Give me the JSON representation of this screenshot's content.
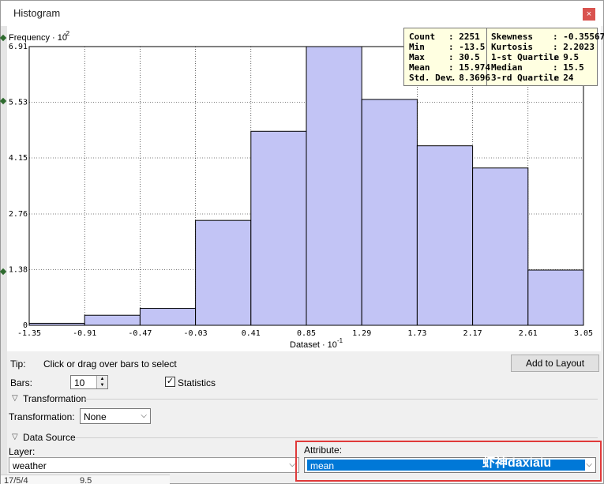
{
  "window": {
    "title": "Histogram",
    "close_glyph": "×"
  },
  "chart_data": {
    "type": "bar",
    "y_axis_title": "Frequency · 10",
    "y_exponent": "-2",
    "x_axis_title": "Dataset · 10",
    "x_exponent": "-1",
    "x_ticks": [
      "-1.35",
      "-0.91",
      "-0.47",
      "-0.03",
      "0.41",
      "0.85",
      "1.29",
      "1.73",
      "2.17",
      "2.61",
      "3.05"
    ],
    "y_ticks": [
      "0",
      "1.38",
      "2.76",
      "4.15",
      "5.53",
      "6.91"
    ],
    "ylim": [
      0,
      6.91
    ],
    "bin_edges": [
      -1.35,
      -0.91,
      -0.47,
      -0.03,
      0.41,
      0.85,
      1.29,
      1.73,
      2.17,
      2.61,
      3.05
    ],
    "values": [
      0.05,
      0.25,
      0.42,
      2.6,
      4.81,
      7.42,
      5.6,
      4.45,
      3.9,
      1.37
    ],
    "grid": true,
    "bar_color": "#c2c4f5",
    "edge_color": "#000000",
    "clipped_bar_index": 8
  },
  "statistics": {
    "rows": [
      {
        "l": "Count",
        "lv": ": 2251",
        "r": "Skewness",
        "rv": ": -0.35567"
      },
      {
        "l": "Min",
        "lv": ": -13.5",
        "r": "Kurtosis",
        "rv": ": 2.2023"
      },
      {
        "l": "Max",
        "lv": ": 30.5",
        "r": "1-st Quartile",
        "rv": ": 9.5"
      },
      {
        "l": "Mean",
        "lv": ": 15.974",
        "r": "Median",
        "rv": ": 15.5"
      },
      {
        "l": "Std. Dev.",
        "lv": ": 8.3696",
        "r": "3-rd Quartile",
        "rv": ": 24"
      }
    ]
  },
  "controls": {
    "tip_label": "Tip:",
    "tip_text": "Click or drag over bars to select",
    "add_to_layout": "Add to Layout",
    "bars_label": "Bars:",
    "bars_value": "10",
    "statistics_label": "Statistics",
    "statistics_checked": "✓",
    "transformation_section": "Transformation",
    "transformation_label": "Transformation:",
    "transformation_value": "None",
    "data_source_section": "Data Source",
    "layer_label": "Layer:",
    "layer_value": "weather",
    "attribute_label": "Attribute:",
    "attribute_value": "mean"
  },
  "watermark": "虾神daxialu",
  "background_table": {
    "row_date": "17/5/4",
    "row_value": "9.5"
  },
  "colors": {
    "highlight": "#0078d7",
    "frame": "#e03a3a",
    "close": "#d9534f"
  }
}
